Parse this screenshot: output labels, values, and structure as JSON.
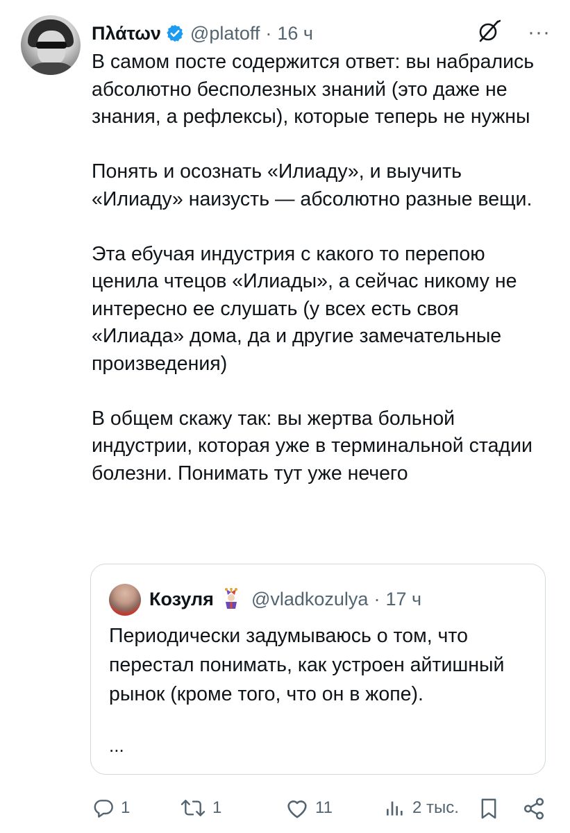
{
  "post": {
    "display_name": "Πλάτων",
    "handle": "@platoff",
    "separator": "·",
    "time": "16 ч",
    "more": "···",
    "paragraphs": [
      "В самом посте содержится ответ: вы набрались абсолютно бесполезных знаний (это даже не знания, а рефлексы), которые теперь не нужны",
      "Понять и осознать «Илиаду», и выучить «Илиаду» наизусть — абсолютно разные вещи.",
      "Эта ебучая индустрия с какого то перепою ценила чтецов «Илиады», а сейчас никому не интересно ее слушать (у всех есть своя «Илиада» дома, да и другие замечательные произведения)",
      "В общем скажу так: вы жертва больной индустрии, которая уже в терминальной стадии болезни. Понимать тут уже нечего"
    ]
  },
  "quote": {
    "display_name": "Козуля",
    "handle": "@vladkozulya",
    "separator": "·",
    "time": "17 ч",
    "text": "Периодически задумываюсь о том, что перестал понимать, как устроен айтишный рынок (кроме того, что он в жопе).",
    "ellipsis": "..."
  },
  "actions": {
    "replies": "1",
    "reposts": "1",
    "likes": "11",
    "views": "2 тыс."
  },
  "colors": {
    "text": "#0f1419",
    "secondary": "#536471",
    "verified": "#1d9bf0",
    "border": "#cfd9de"
  },
  "icons": [
    "verified-badge-icon",
    "grok-icon",
    "more-icon",
    "jester-badge-icon",
    "reply-icon",
    "repost-icon",
    "like-icon",
    "views-icon",
    "bookmark-icon",
    "share-icon"
  ]
}
